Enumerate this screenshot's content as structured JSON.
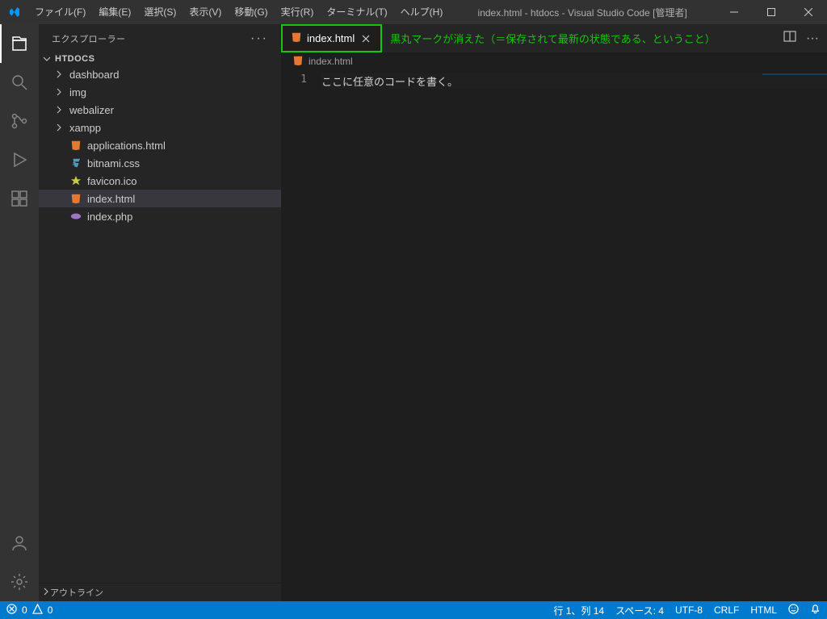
{
  "window": {
    "title": "index.html - htdocs - Visual Studio Code [管理者]"
  },
  "menu": {
    "file": "ファイル(F)",
    "edit": "編集(E)",
    "select": "選択(S)",
    "view": "表示(V)",
    "go": "移動(G)",
    "run": "実行(R)",
    "terminal": "ターミナル(T)",
    "help": "ヘルプ(H)"
  },
  "sidebar": {
    "title": "エクスプローラー",
    "folder": "HTDOCS",
    "items": [
      {
        "kind": "folder",
        "label": "dashboard"
      },
      {
        "kind": "folder",
        "label": "img"
      },
      {
        "kind": "folder",
        "label": "webalizer"
      },
      {
        "kind": "folder",
        "label": "xampp"
      },
      {
        "kind": "html",
        "label": "applications.html"
      },
      {
        "kind": "css",
        "label": "bitnami.css"
      },
      {
        "kind": "fav",
        "label": "favicon.ico"
      },
      {
        "kind": "html",
        "label": "index.html",
        "selected": true
      },
      {
        "kind": "php",
        "label": "index.php"
      }
    ],
    "outline": "アウトライン"
  },
  "tab": {
    "name": "index.html",
    "annotation": "黒丸マークが消えた（＝保存されて最新の状態である、ということ）"
  },
  "breadcrumb": {
    "file": "index.html"
  },
  "editor": {
    "line_number": "1",
    "content": "ここに任意のコードを書く。"
  },
  "status": {
    "errors": "0",
    "warnings": "0",
    "cursor": "行 1、列 14",
    "spaces": "スペース: 4",
    "encoding": "UTF-8",
    "eol": "CRLF",
    "lang": "HTML"
  }
}
